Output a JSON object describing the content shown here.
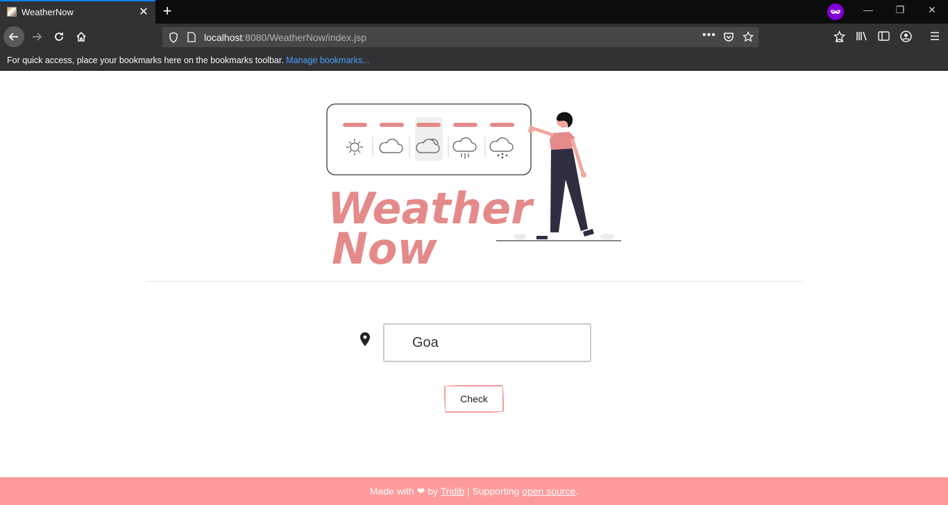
{
  "browser": {
    "tab_title": "WeatherNow",
    "url_host": "localhost",
    "url_path": ":8080/WeatherNow/index.jsp",
    "bookmarks_prompt": "For quick access, place your bookmarks here on the bookmarks toolbar.",
    "bookmarks_link": "Manage bookmarks..."
  },
  "hero": {
    "title_line1": "Weather",
    "title_line2": "Now"
  },
  "search": {
    "value": "Goa",
    "button_label": "Check"
  },
  "footer": {
    "made_with": "Made with",
    "by": "by",
    "author": "Tridib",
    "separator": "| Supporting",
    "oss": "open source",
    "period": "."
  },
  "colors": {
    "accent": "#e58a8a",
    "footer_bg": "#ff9a9a",
    "browser_dark": "#323234",
    "url_blue": "#45a1ff"
  }
}
